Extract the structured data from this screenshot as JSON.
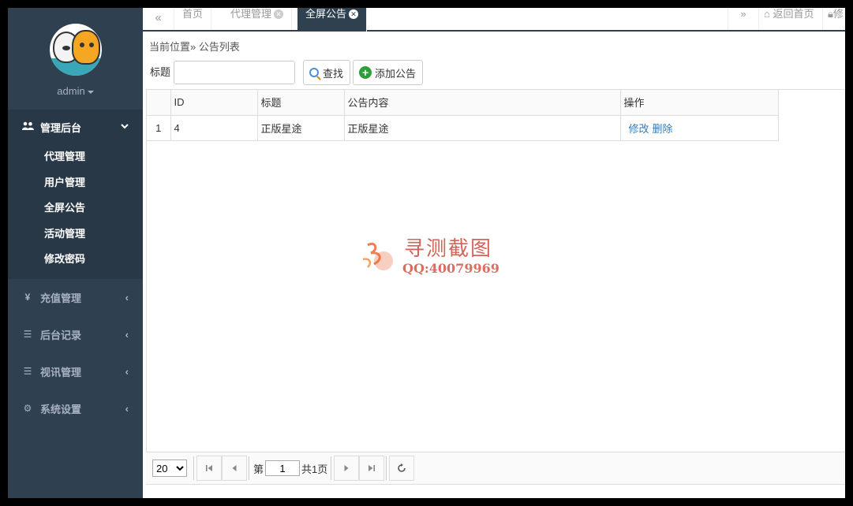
{
  "user": {
    "name": "admin"
  },
  "sidebar": {
    "group": {
      "label": "管理后台",
      "icon": "users-icon",
      "items": [
        {
          "label": "代理管理"
        },
        {
          "label": "用户管理"
        },
        {
          "label": "全屏公告"
        },
        {
          "label": "活动管理"
        },
        {
          "label": "修改密码"
        }
      ]
    },
    "menus": [
      {
        "label": "充值管理",
        "icon": "yen-icon",
        "glyph": "¥"
      },
      {
        "label": "后台记录",
        "icon": "list-icon",
        "glyph": "☰"
      },
      {
        "label": "视讯管理",
        "icon": "indent-list-icon",
        "glyph": "☰"
      },
      {
        "label": "系统设置",
        "icon": "gears-icon",
        "glyph": "⚙"
      }
    ]
  },
  "tabs": {
    "prev": "«",
    "next": "»",
    "items": [
      {
        "label": "首页",
        "active": false,
        "closable": false
      },
      {
        "label": "代理管理",
        "active": false,
        "closable": true
      },
      {
        "label": "全屏公告",
        "active": true,
        "closable": true
      }
    ],
    "home_link": "返回首页",
    "lock_link": "修"
  },
  "breadcrumb": "当前位置» 公告列表",
  "search": {
    "label": "标题",
    "value": "",
    "find_button": "查找",
    "add_button": "添加公告"
  },
  "table": {
    "columns": [
      "ID",
      "标题",
      "公告内容",
      "操作"
    ],
    "rows": [
      {
        "index": "1",
        "id": "4",
        "title": "正版星途",
        "content": "正版星途",
        "edit": "修改",
        "delete": "删除"
      }
    ]
  },
  "pager": {
    "page_size": "20",
    "page_size_options": [
      "20"
    ],
    "page_prefix": "第",
    "page": "1",
    "total": "共1页"
  },
  "watermark": {
    "text": "寻测截图",
    "qq": "QQ:40079969"
  },
  "colors": {
    "sidebar": "#2f4050",
    "sidebar_active": "#293846",
    "link": "#337ab7"
  }
}
